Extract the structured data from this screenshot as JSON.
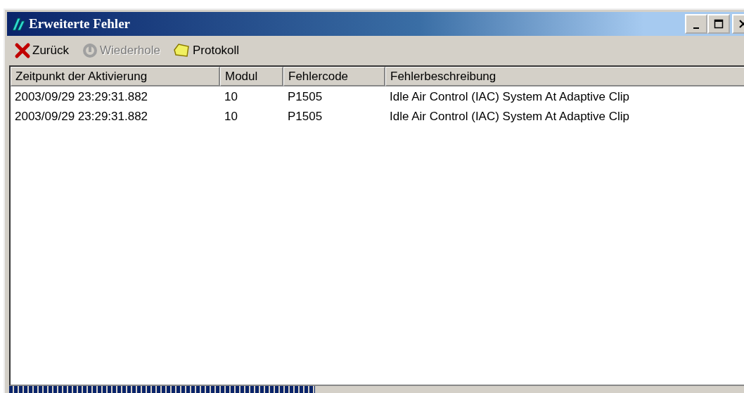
{
  "window": {
    "title": "Erweiterte Fehler"
  },
  "toolbar": [
    {
      "label": "Zurück",
      "kind": "back",
      "disabled": false
    },
    {
      "label": "Wiederhole",
      "kind": "retry",
      "disabled": true
    },
    {
      "label": "Protokoll",
      "kind": "log",
      "disabled": false
    }
  ],
  "table": {
    "columns": [
      "Zeitpunkt der Aktivierung",
      "Modul",
      "Fehlercode",
      "Fehlerbeschreibung"
    ],
    "rows": [
      [
        "2003/09/29 23:29:31.882",
        "10",
        "P1505",
        "Idle Air Control (IAC) System At Adaptive Clip"
      ],
      [
        "2003/09/29 23:29:31.882",
        "10",
        "P1505",
        "Idle Air Control (IAC) System At Adaptive Clip"
      ]
    ]
  },
  "progress": {
    "level": 0.41
  }
}
